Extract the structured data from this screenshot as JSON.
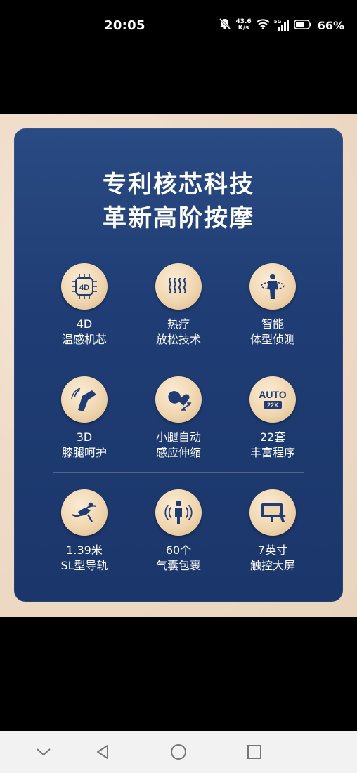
{
  "status_bar": {
    "time": "20:05",
    "net_speed_value": "43.6",
    "net_speed_unit": "K/s",
    "signal_label": "5G",
    "battery": "66%"
  },
  "card": {
    "title_line1": "专利核芯科技",
    "title_line2": "革新高阶按摩",
    "features": [
      {
        "line1": "4D",
        "line2": "温感机芯",
        "icon": "4d-chip-icon",
        "badge": "4D"
      },
      {
        "line1": "热疗",
        "line2": "放松技术",
        "icon": "heat-waves-icon"
      },
      {
        "line1": "智能",
        "line2": "体型侦测",
        "icon": "body-scan-icon"
      },
      {
        "line1": "3D",
        "line2": "膝腿呵护",
        "icon": "knee-leg-icon"
      },
      {
        "line1": "小腿自动",
        "line2": "感应伸缩",
        "icon": "calf-extend-icon"
      },
      {
        "line1": "22套",
        "line2": "丰富程序",
        "icon": "auto-program-icon",
        "badge": "AUTO",
        "badge_sub": "22X"
      },
      {
        "line1": "1.39米",
        "line2": "SL型导轨",
        "icon": "sl-rail-icon"
      },
      {
        "line1": "60个",
        "line2": "气囊包裹",
        "icon": "airbag-icon"
      },
      {
        "line1": "7英寸",
        "line2": "触控大屏",
        "icon": "touch-screen-icon"
      }
    ]
  },
  "colors": {
    "card_blue": "#1f3d74",
    "icon_gold": "#f0d6b0",
    "icon_dark": "#1f3d74"
  },
  "nav": {
    "icons": [
      "chevron-down-icon",
      "back-icon",
      "home-icon",
      "recents-icon"
    ]
  }
}
